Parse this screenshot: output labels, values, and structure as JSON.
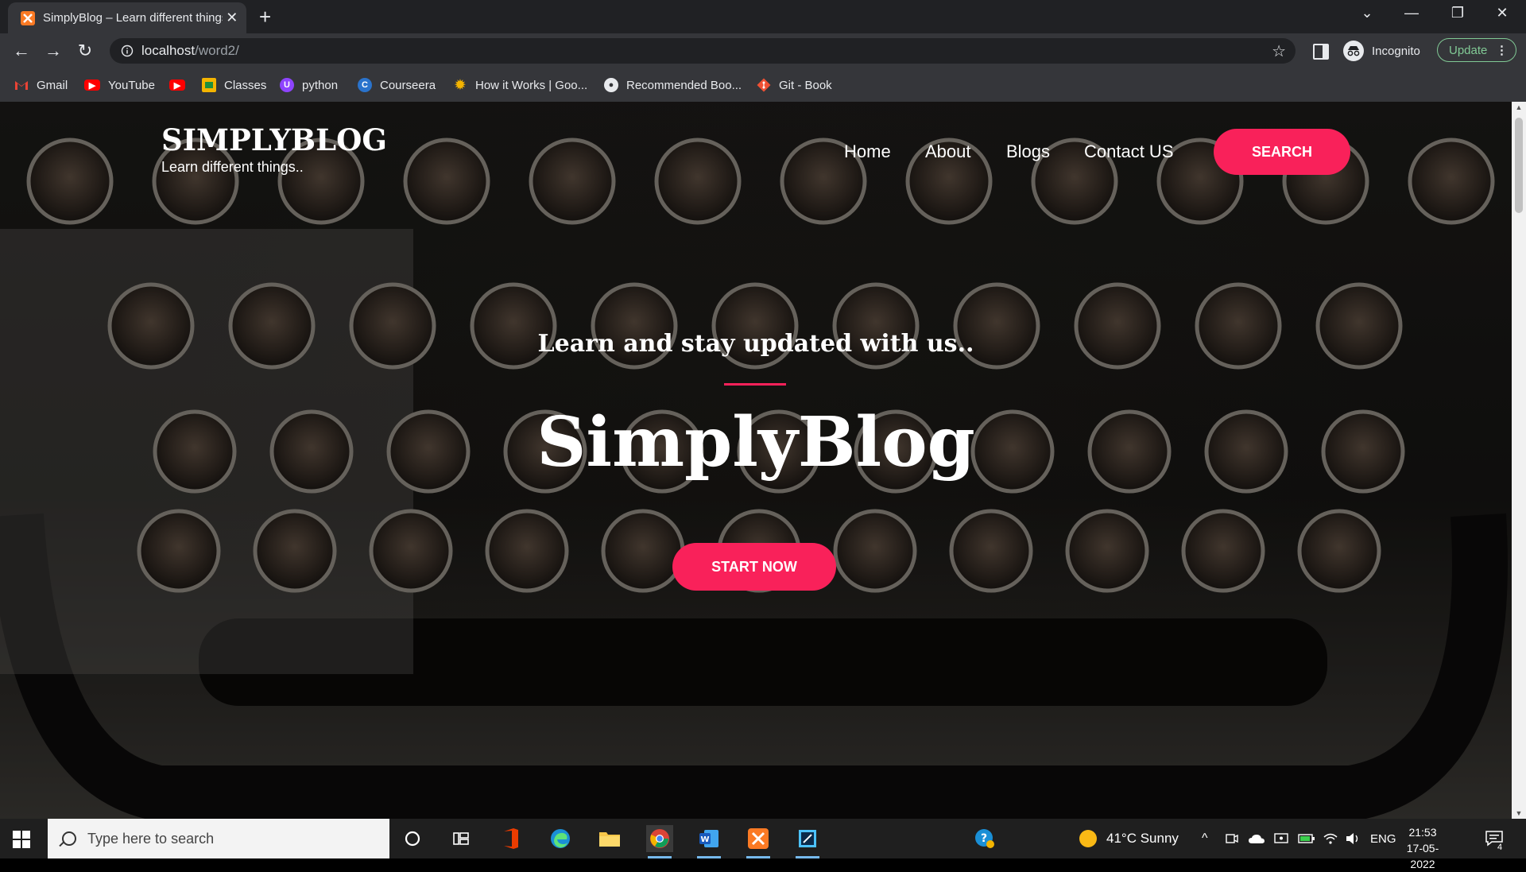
{
  "browser": {
    "tab_title": "SimplyBlog – Learn different things..",
    "url_host": "localhost",
    "url_path": "/word2/",
    "incognito_label": "Incognito",
    "update_label": "Update"
  },
  "bookmarks": [
    {
      "label": "Gmail",
      "icon": "gmail-icon"
    },
    {
      "label": "YouTube",
      "icon": "youtube-icon"
    },
    {
      "label": "",
      "icon": "youtube-icon"
    },
    {
      "label": "Classes",
      "icon": "classroom-icon"
    },
    {
      "label": "python",
      "icon": "python-icon"
    },
    {
      "label": "Courseera",
      "icon": "coursera-icon"
    },
    {
      "label": "How it Works | Goo...",
      "icon": "sun-icon"
    },
    {
      "label": "Recommended Boo...",
      "icon": "book-icon"
    },
    {
      "label": "Git - Book",
      "icon": "git-icon"
    }
  ],
  "site": {
    "brand_name": "SIMPLYBLOG",
    "brand_tagline": "Learn different things..",
    "nav": [
      "Home",
      "About",
      "Blogs",
      "Contact US"
    ],
    "search_label": "SEARCH",
    "hero_subtitle": "Learn and stay updated with us..",
    "hero_title": "SimplyBlog",
    "cta_label": "START NOW",
    "accent_color": "#f9215a"
  },
  "taskbar": {
    "search_placeholder": "Type here to search",
    "weather": "41°C  Sunny",
    "language": "ENG",
    "time": "21:53",
    "date": "17-05-2022",
    "notifications": "4"
  }
}
